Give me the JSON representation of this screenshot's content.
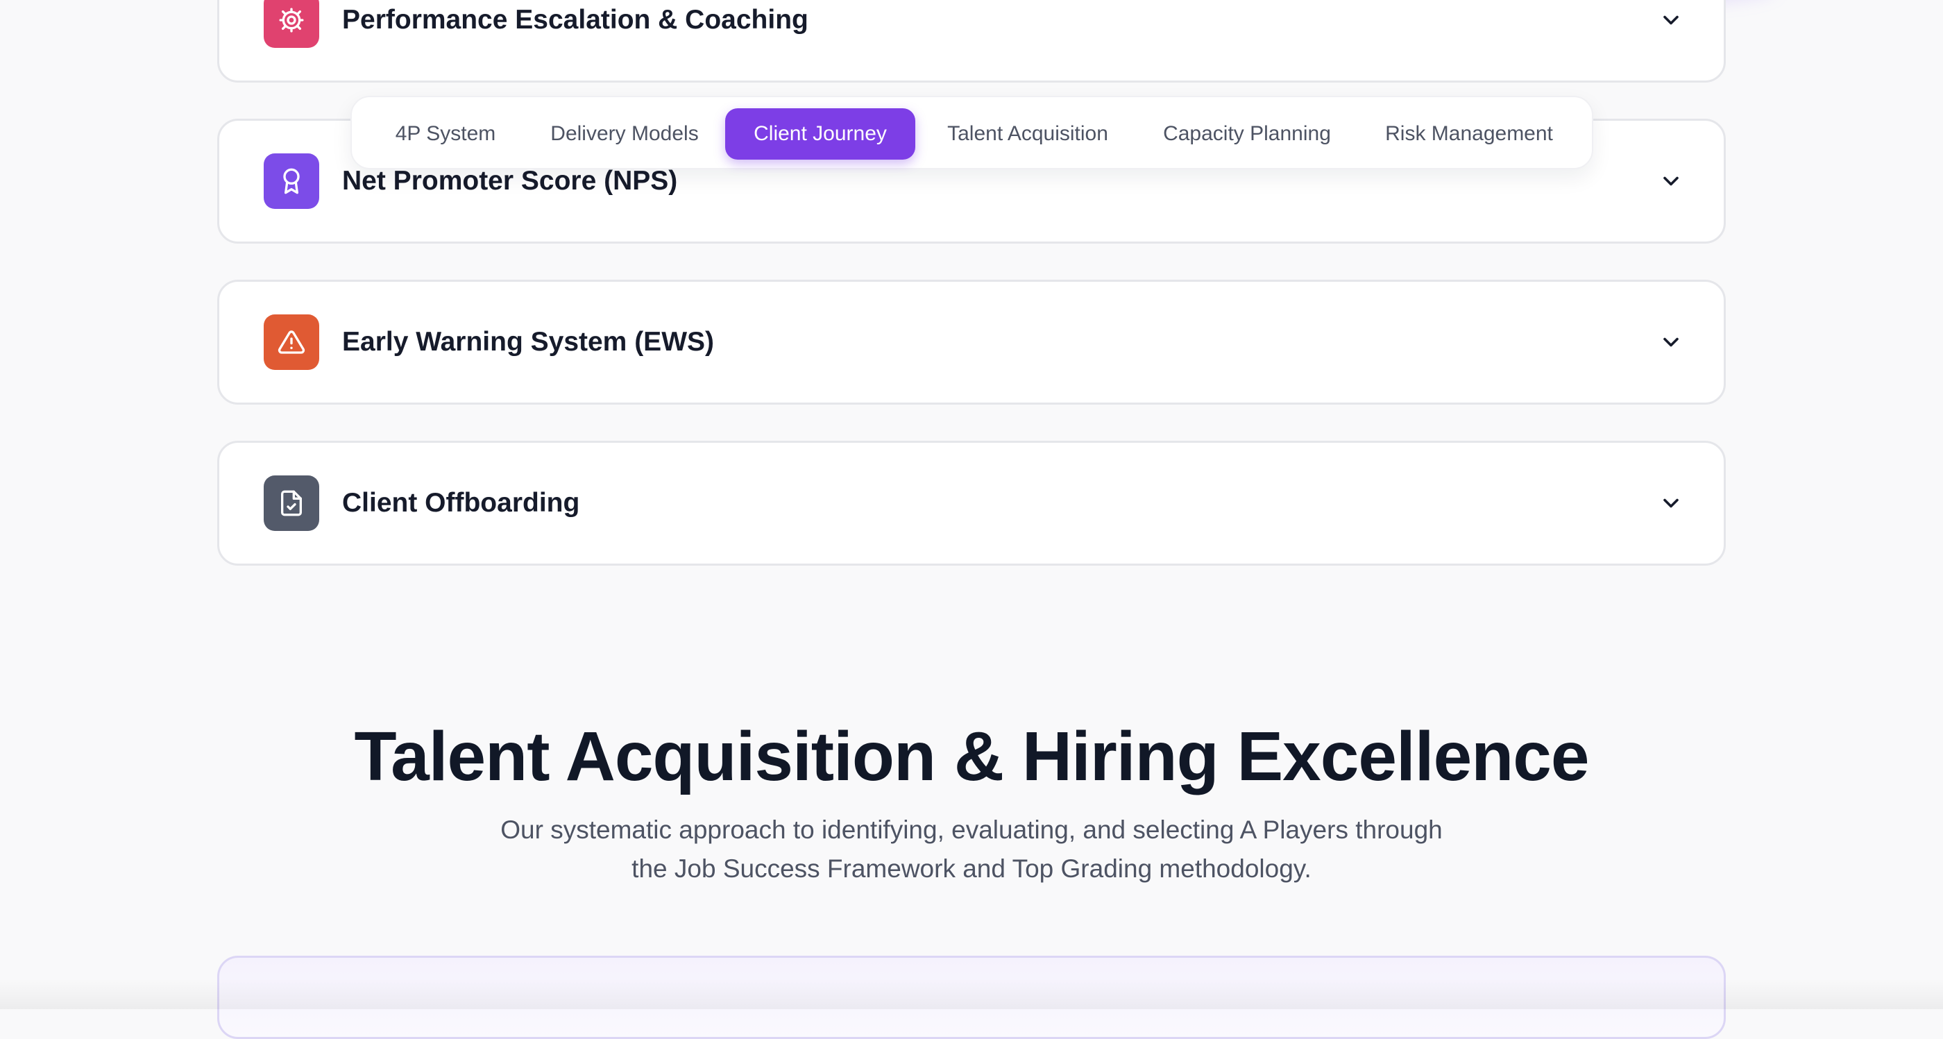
{
  "accordions": [
    {
      "title": "Performance Escalation & Coaching",
      "icon": "gear-icon",
      "color": "#e0426f"
    },
    {
      "title": "Net Promoter Score (NPS)",
      "icon": "award-icon",
      "color": "#7c4ce8"
    },
    {
      "title": "Early Warning System (EWS)",
      "icon": "warning-triangle-icon",
      "color": "#e05a33"
    },
    {
      "title": "Client Offboarding",
      "icon": "file-check-icon",
      "color": "#535a6a"
    }
  ],
  "tabs": {
    "items": [
      "4P System",
      "Delivery Models",
      "Client Journey",
      "Talent Acquisition",
      "Capacity Planning",
      "Risk Management"
    ],
    "active": "Client Journey",
    "accent_color": "#7d3ee6"
  },
  "section": {
    "title": "Talent Acquisition & Hiring Excellence",
    "subtitle_line1": "Our systematic approach to identifying, evaluating, and selecting A Players through",
    "subtitle_line2": "the Job Success Framework and Top Grading methodology."
  }
}
